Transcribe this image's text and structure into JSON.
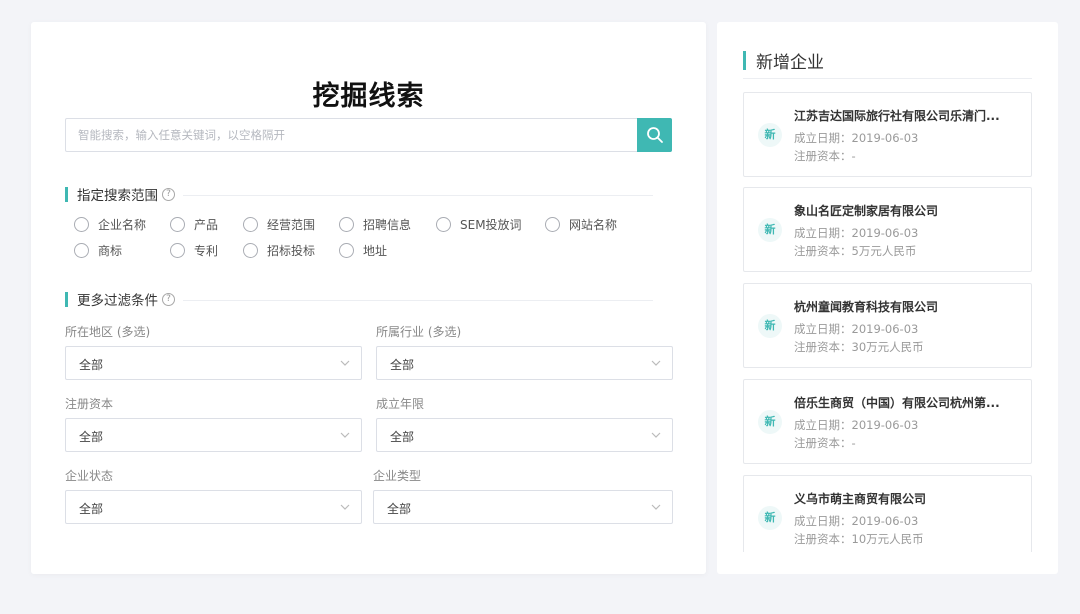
{
  "main": {
    "title": "挖掘线索",
    "search": {
      "placeholder": "智能搜索，输入任意关键词，以空格隔开",
      "value": "",
      "button_icon": "search-icon"
    },
    "scope_section": {
      "title": "指定搜索范围",
      "help_icon": "question-circle-icon",
      "options": [
        "企业名称",
        "产品",
        "经营范围",
        "招聘信息",
        "SEM投放词",
        "网站名称",
        "商标",
        "专利",
        "招标投标",
        "地址"
      ]
    },
    "filter_section": {
      "title": "更多过滤条件",
      "help_icon": "question-circle-icon",
      "filters": [
        {
          "label": "所在地区 (多选)",
          "value": "全部"
        },
        {
          "label": "所属行业 (多选)",
          "value": "全部"
        },
        {
          "label": "注册资本",
          "value": "全部"
        },
        {
          "label": "成立年限",
          "value": "全部"
        },
        {
          "label": "企业状态",
          "value": "全部"
        },
        {
          "label": "企业类型",
          "value": "全部"
        }
      ]
    }
  },
  "sidebar": {
    "title": "新增企业",
    "badge": "新",
    "companies": [
      {
        "name": "江苏吉达国际旅行社有限公司乐清门...",
        "date": "成立日期：2019-06-03",
        "capital": "注册资本：-"
      },
      {
        "name": "象山名匠定制家居有限公司",
        "date": "成立日期：2019-06-03",
        "capital": "注册资本：5万元人民币"
      },
      {
        "name": "杭州童闻教育科技有限公司",
        "date": "成立日期：2019-06-03",
        "capital": "注册资本：30万元人民币"
      },
      {
        "name": "倍乐生商贸（中国）有限公司杭州第...",
        "date": "成立日期：2019-06-03",
        "capital": "注册资本：-"
      },
      {
        "name": "义乌市萌主商贸有限公司",
        "date": "成立日期：2019-06-03",
        "capital": "注册资本：10万元人民币"
      }
    ]
  },
  "colors": {
    "accent": "#3fb8b3",
    "background": "#f3f4f8"
  }
}
